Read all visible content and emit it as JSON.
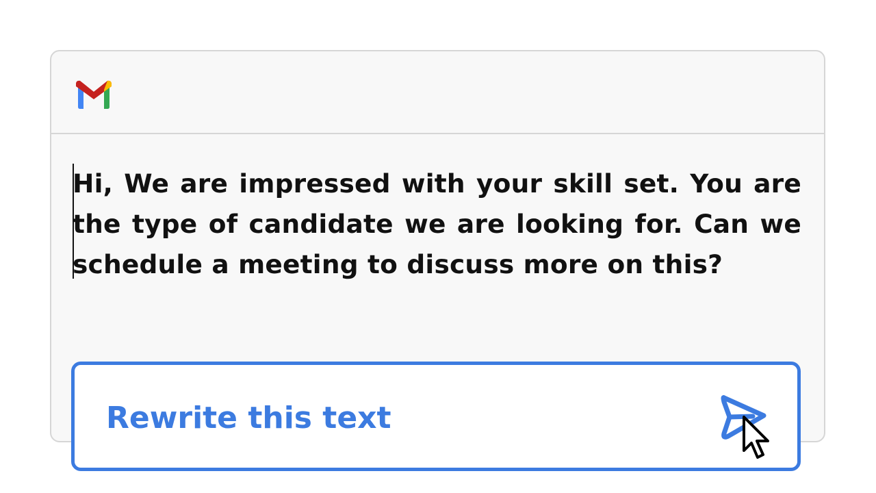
{
  "app": {
    "logo_icon": "gmail-logo",
    "colors": {
      "gmail_red": "#c5221f",
      "gmail_blue": "#4285f4",
      "gmail_green": "#34a853",
      "gmail_yellow": "#fbbc04",
      "accent": "#3c7be0"
    }
  },
  "email": {
    "body": "Hi, We are impressed with your skill set. You are the type of candidate we are looking for. Can we schedule a meeting to discuss more on this?"
  },
  "prompt": {
    "text": "Rewrite this text",
    "send_icon": "send-icon",
    "cursor_icon": "mouse-pointer-icon"
  }
}
